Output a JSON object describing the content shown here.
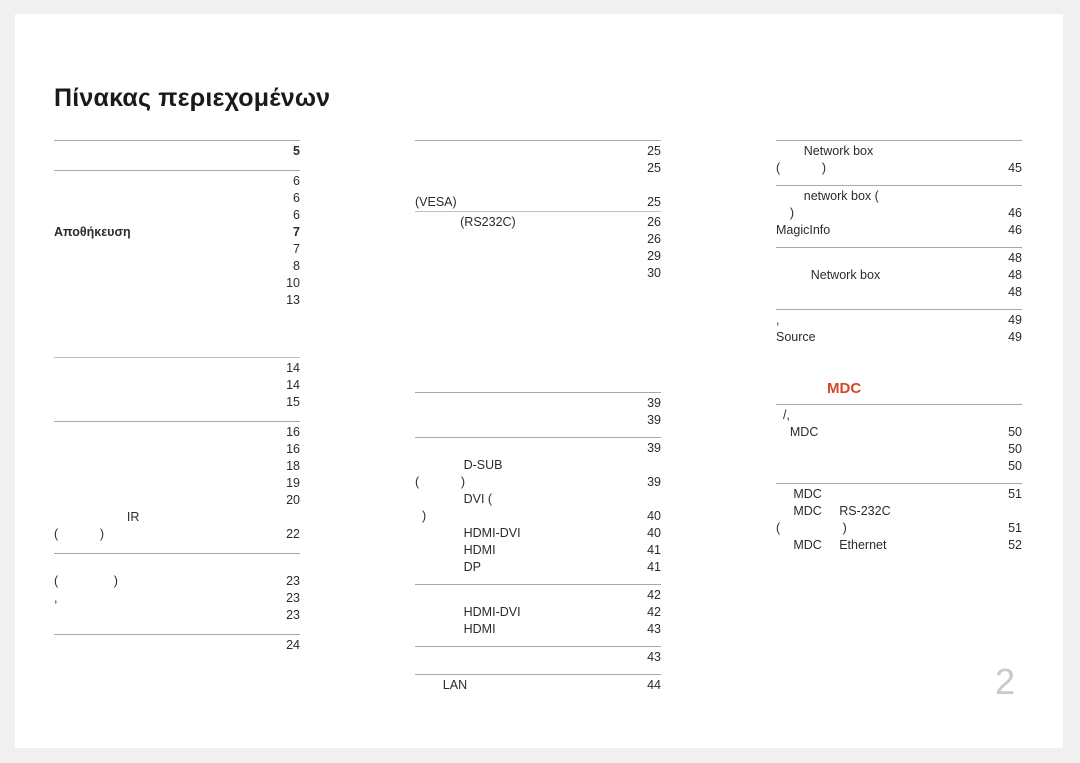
{
  "document": {
    "title": "Πίνακας περιεχομένων",
    "page_number": "2",
    "accent_color": "#d4462a",
    "rule_color": "#a8a8a8",
    "rule_color_alt": "#b9bfcf",
    "background_color": "#f0f0f0",
    "sheet_color": "#ffffff"
  },
  "columns": [
    {
      "id": "column-1",
      "blocks": [
        {
          "id": "block-1-1",
          "rule": "gray",
          "heading": "",
          "rows": [
            {
              "label": "",
              "page": "5",
              "bold": true
            }
          ]
        },
        {
          "id": "block-1-2",
          "rule": "gray",
          "heading": "",
          "rows": [
            {
              "label": "",
              "page": "6",
              "bold": false
            },
            {
              "label": "",
              "page": "6",
              "bold": false
            },
            {
              "label": "",
              "page": "6",
              "bold": false
            },
            {
              "label": "Αποθήκευση",
              "page": "7",
              "bold": true
            },
            {
              "label": "",
              "page": "7",
              "bold": false
            },
            {
              "label": "",
              "page": "8",
              "bold": false
            },
            {
              "label": "",
              "page": "10",
              "bold": false
            },
            {
              "label": "",
              "page": "13",
              "bold": false
            }
          ]
        },
        {
          "id": "block-1-3",
          "rule": "blue",
          "heading": "",
          "rows": [
            {
              "label": "",
              "page": "14",
              "bold": false
            },
            {
              "label": "",
              "page": "14",
              "bold": false
            },
            {
              "label": "",
              "page": "15",
              "bold": false
            }
          ]
        },
        {
          "id": "block-1-4",
          "rule": "gray",
          "heading": "",
          "rows": [
            {
              "label": "",
              "page": "16",
              "bold": false
            },
            {
              "label": "",
              "page": "16",
              "bold": false
            },
            {
              "label": "",
              "page": "18",
              "bold": false
            },
            {
              "label": "",
              "page": "19",
              "bold": false
            },
            {
              "label": "",
              "page": "20",
              "bold": false
            },
            {
              "label": "                     IR",
              "page": "",
              "bold": false
            },
            {
              "label": "(            )",
              "page": "22",
              "bold": false
            }
          ]
        },
        {
          "id": "block-1-5",
          "rule": "gray",
          "heading": "",
          "rows": [
            {
              "label": "",
              "page": "",
              "bold": false
            },
            {
              "label": "(                )",
              "page": "23",
              "bold": false
            },
            {
              "label": ",",
              "page": "23",
              "bold": false
            },
            {
              "label": "",
              "page": "23",
              "bold": false
            }
          ]
        },
        {
          "id": "block-1-6",
          "rule": "gray",
          "heading": "",
          "rows": [
            {
              "label": "",
              "page": "24",
              "bold": false
            }
          ]
        }
      ]
    },
    {
      "id": "column-2",
      "blocks": [
        {
          "id": "block-2-1",
          "rule": "gray",
          "heading": "",
          "rows": [
            {
              "label": "",
              "page": "25",
              "bold": false
            },
            {
              "label": "",
              "page": "25",
              "bold": false
            },
            {
              "label": "",
              "page": "",
              "bold": false
            },
            {
              "label": "(VESA)",
              "page": "25",
              "bold": false
            }
          ]
        },
        {
          "id": "block-2-2",
          "rule": "blue",
          "heading": "",
          "rows": [
            {
              "label": "             (RS232C)",
              "page": "26",
              "bold": false
            },
            {
              "label": "",
              "page": "26",
              "bold": false
            },
            {
              "label": "",
              "page": "29",
              "bold": false
            },
            {
              "label": "",
              "page": "30",
              "bold": false
            }
          ]
        },
        {
          "id": "block-2-3",
          "rule": "gray",
          "heading": "",
          "rows": [
            {
              "label": "",
              "page": "39",
              "bold": false
            },
            {
              "label": "",
              "page": "39",
              "bold": false
            }
          ]
        },
        {
          "id": "block-2-4",
          "rule": "gray",
          "heading": "",
          "rows": [
            {
              "label": "",
              "page": "39",
              "bold": false
            },
            {
              "label": "              D-SUB",
              "page": "",
              "bold": false
            },
            {
              "label": "(            )",
              "page": "39",
              "bold": false
            },
            {
              "label": "              DVI (",
              "page": "",
              "bold": false
            },
            {
              "label": "  )",
              "page": "40",
              "bold": false
            },
            {
              "label": "              HDMI-DVI",
              "page": "40",
              "bold": false
            },
            {
              "label": "              HDMI",
              "page": "41",
              "bold": false
            },
            {
              "label": "              DP",
              "page": "41",
              "bold": false
            }
          ]
        },
        {
          "id": "block-2-5",
          "rule": "gray",
          "heading": "",
          "rows": [
            {
              "label": "",
              "page": "42",
              "bold": false
            },
            {
              "label": "              HDMI-DVI",
              "page": "42",
              "bold": false
            },
            {
              "label": "              HDMI",
              "page": "43",
              "bold": false
            }
          ]
        },
        {
          "id": "block-2-6",
          "rule": "gray",
          "heading": "",
          "rows": [
            {
              "label": "",
              "page": "43",
              "bold": false
            }
          ]
        },
        {
          "id": "block-2-7",
          "rule": "gray",
          "heading": "",
          "rows": [
            {
              "label": "        LAN",
              "page": "44",
              "bold": false
            }
          ]
        }
      ]
    },
    {
      "id": "column-3",
      "blocks": [
        {
          "id": "block-3-1",
          "rule": "gray",
          "heading": "",
          "rows": [
            {
              "label": "        Network box",
              "page": "",
              "bold": false
            },
            {
              "label": "(            )",
              "page": "45",
              "bold": false
            }
          ]
        },
        {
          "id": "block-3-2",
          "rule": "gray",
          "heading": "",
          "rows": [
            {
              "label": "        network box (",
              "page": "",
              "bold": false
            },
            {
              "label": "    )",
              "page": "46",
              "bold": false
            },
            {
              "label": "MagicInfo",
              "page": "46",
              "bold": false
            }
          ]
        },
        {
          "id": "block-3-3",
          "rule": "gray",
          "heading": "",
          "rows": [
            {
              "label": "",
              "page": "48",
              "bold": false
            },
            {
              "label": "          Network box",
              "page": "48",
              "bold": false
            },
            {
              "label": "",
              "page": "48",
              "bold": false
            }
          ]
        },
        {
          "id": "block-3-4",
          "rule": "gray",
          "heading": "",
          "rows": [
            {
              "label": ",",
              "page": "49",
              "bold": false
            },
            {
              "label": "Source",
              "page": "49",
              "bold": false
            }
          ]
        },
        {
          "id": "block-3-5",
          "rule": "gray",
          "heading": "MDC",
          "rows": [
            {
              "label": "  /,",
              "page": "",
              "bold": false
            },
            {
              "label": "    MDC",
              "page": "50",
              "bold": false
            },
            {
              "label": "",
              "page": "50",
              "bold": false
            },
            {
              "label": "",
              "page": "50",
              "bold": false
            }
          ]
        },
        {
          "id": "block-3-6",
          "rule": "gray",
          "heading": "",
          "rows": [
            {
              "label": "     MDC",
              "page": "51",
              "bold": false
            },
            {
              "label": "     MDC     RS-232C",
              "page": "",
              "bold": false
            },
            {
              "label": "(                  )",
              "page": "51",
              "bold": false
            },
            {
              "label": "     MDC     Ethernet",
              "page": "52",
              "bold": false
            }
          ]
        }
      ]
    }
  ]
}
